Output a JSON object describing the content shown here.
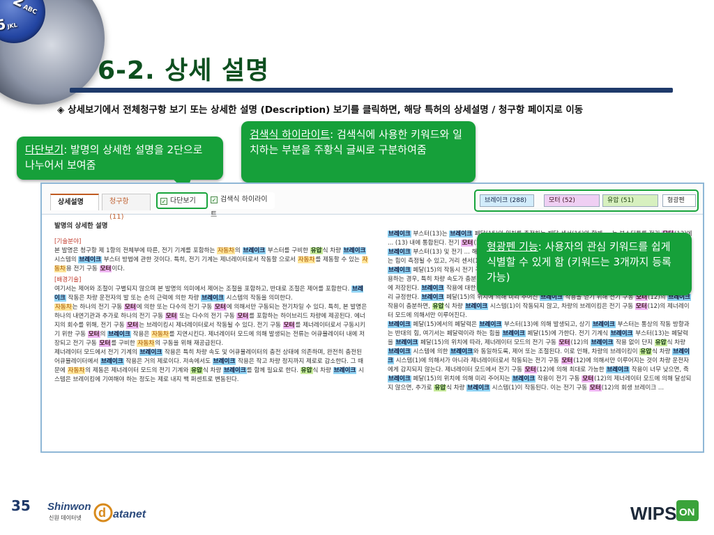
{
  "slide": {
    "title": "6-2. 상세 설명",
    "page_number": "35",
    "intro_text": "◈ 상세보기에서 전체청구항 보기 또는 상세한 설명 (Description) 보기를 클릭하면, 해당 특허의 상세설명 / 청구항 페이지로 이동"
  },
  "callouts": {
    "split_view": {
      "term": "다단보기",
      "text": ": 발명의 상세한 설명을 2단으로 나누어서 보여줌"
    },
    "search_highlight": {
      "term": "검색식 하이라이트",
      "text": ": 검색식에 사용한 키워드와 일치하는 부분을 주황식 글씨로 구분하여줌"
    },
    "highlighter": {
      "term": "형광펜 기능",
      "text": ": 사용자의 관심 키워드를 쉽게 식별할 수 있게 함 (키워드는 3개까지 등록 가능)"
    }
  },
  "screenshot": {
    "tabs": [
      "상세설명",
      "청구항 (11)"
    ],
    "tools": {
      "split_view": "다단보기",
      "search_highlight": "검색식 하이라이트"
    },
    "highlights": [
      {
        "label": "브레이크 (288)",
        "color": "#d2ecfb"
      },
      {
        "label": "모터 (52)",
        "color": "#efcff3"
      },
      {
        "label": "유압 (51)",
        "color": "#d7f0bf"
      }
    ],
    "highlight_close": "형광펜",
    "left_column": {
      "heading": "발명의 상세한 설명",
      "section1": "[기술분야]",
      "section2": "[배경기술]"
    }
  },
  "footer": {
    "logo_left": "Shinwon",
    "logo_left_sub": "신원 데이터넷",
    "logo_left_brand": "atanet",
    "logo_right": "WIPS",
    "logo_right_badge": "ON"
  },
  "colors": {
    "title_green": "#0d4f1f",
    "callout_green": "#16a03a",
    "rule_navy": "#1f3a6a"
  }
}
